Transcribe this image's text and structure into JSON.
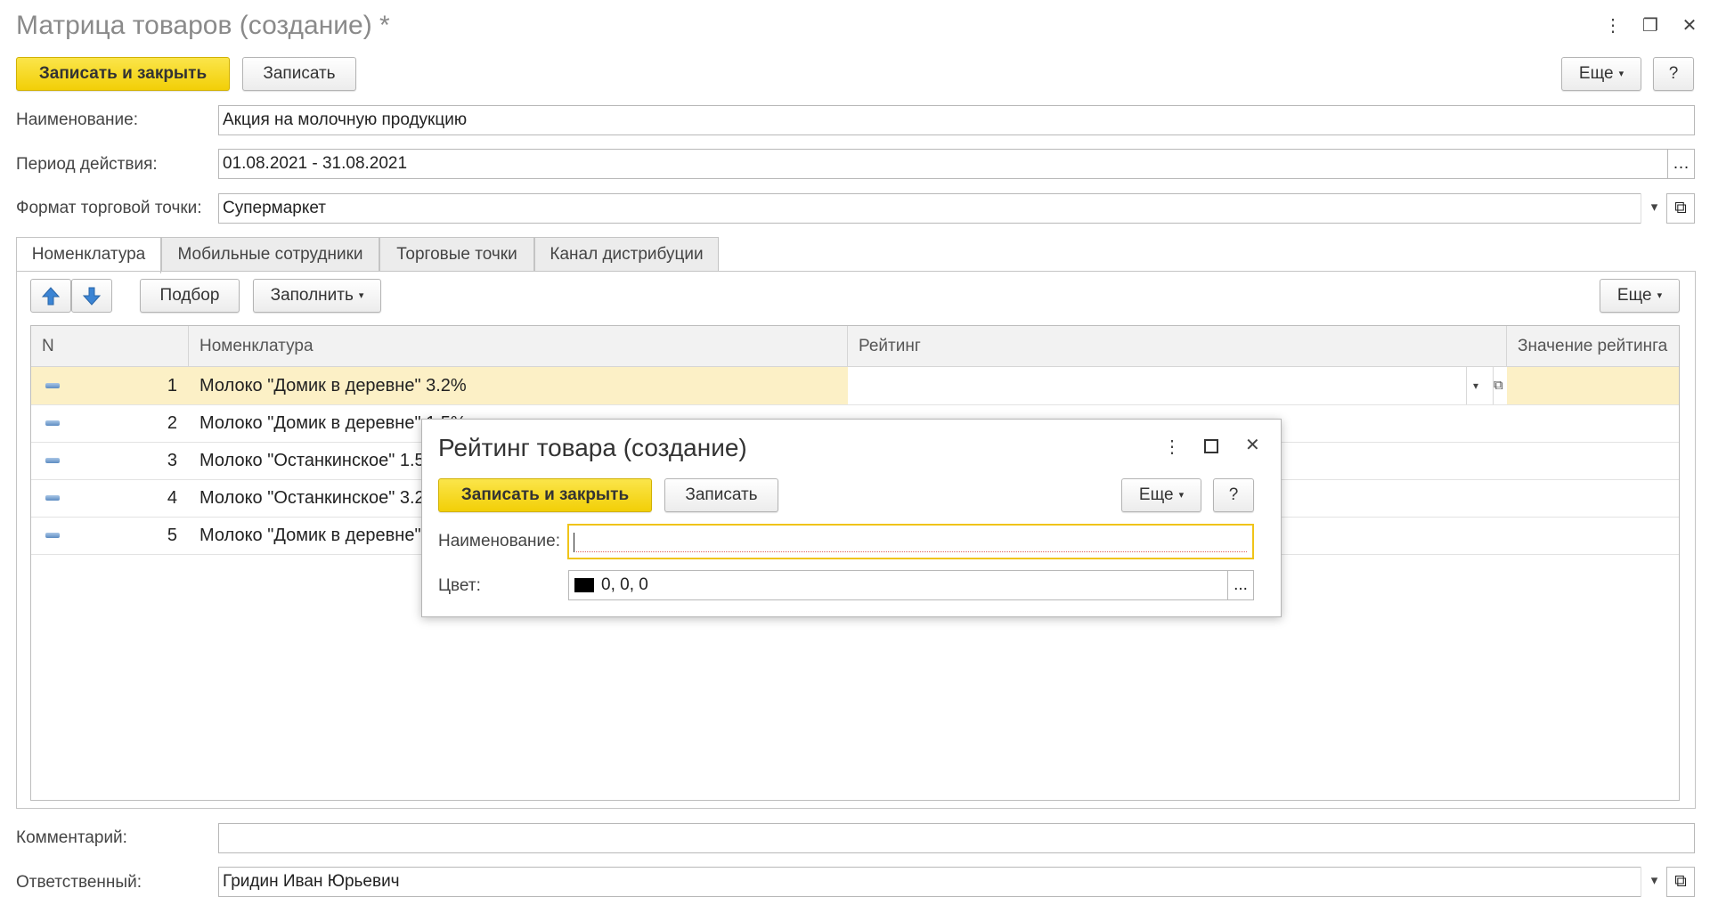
{
  "window": {
    "title": "Матрица товаров (создание) *",
    "menu_icon": "⋮",
    "restore_icon": "❐",
    "close_icon": "✕"
  },
  "toolbar": {
    "save_close_label": "Записать и закрыть",
    "save_label": "Записать",
    "more_label": "Еще",
    "help_label": "?"
  },
  "form": {
    "name_label": "Наименование:",
    "name_value": "Акция на молочную продукцию",
    "period_label": "Период действия:",
    "period_value": "01.08.2021 - 31.08.2021",
    "format_label": "Формат торговой точки:",
    "format_value": "Супермаркет",
    "comment_label": "Комментарий:",
    "comment_value": "",
    "responsible_label": "Ответственный:",
    "responsible_value": "Гридин Иван Юрьевич"
  },
  "tabs": [
    {
      "label": "Номенклатура"
    },
    {
      "label": "Мобильные сотрудники"
    },
    {
      "label": "Торговые точки"
    },
    {
      "label": "Канал дистрибуции"
    }
  ],
  "table_toolbar": {
    "pick_label": "Подбор",
    "fill_label": "Заполнить",
    "more_label": "Еще"
  },
  "table": {
    "columns": [
      "N",
      "Номенклатура",
      "Рейтинг",
      "Значение рейтинга"
    ],
    "rows": [
      {
        "n": "1",
        "item": "Молоко \"Домик в деревне\" 3.2%"
      },
      {
        "n": "2",
        "item": "Молоко \"Домик в деревне\" 1.5%"
      },
      {
        "n": "3",
        "item": "Молоко \"Останкинское\" 1.5"
      },
      {
        "n": "4",
        "item": "Молоко \"Останкинское\" 3.2"
      },
      {
        "n": "5",
        "item": "Молоко \"Домик в деревне\""
      }
    ]
  },
  "dialog": {
    "title": "Рейтинг товара (создание)",
    "save_close_label": "Записать и закрыть",
    "save_label": "Записать",
    "more_label": "Еще",
    "help_label": "?",
    "name_label": "Наименование:",
    "name_value": "",
    "color_label": "Цвет:",
    "color_value": "0, 0, 0",
    "color_swatch": "#000000",
    "ellipsis": "..."
  },
  "colors": {
    "accent": "#f2cf07",
    "selected_row": "#fcf0c6",
    "focus_border": "#f0c419"
  }
}
